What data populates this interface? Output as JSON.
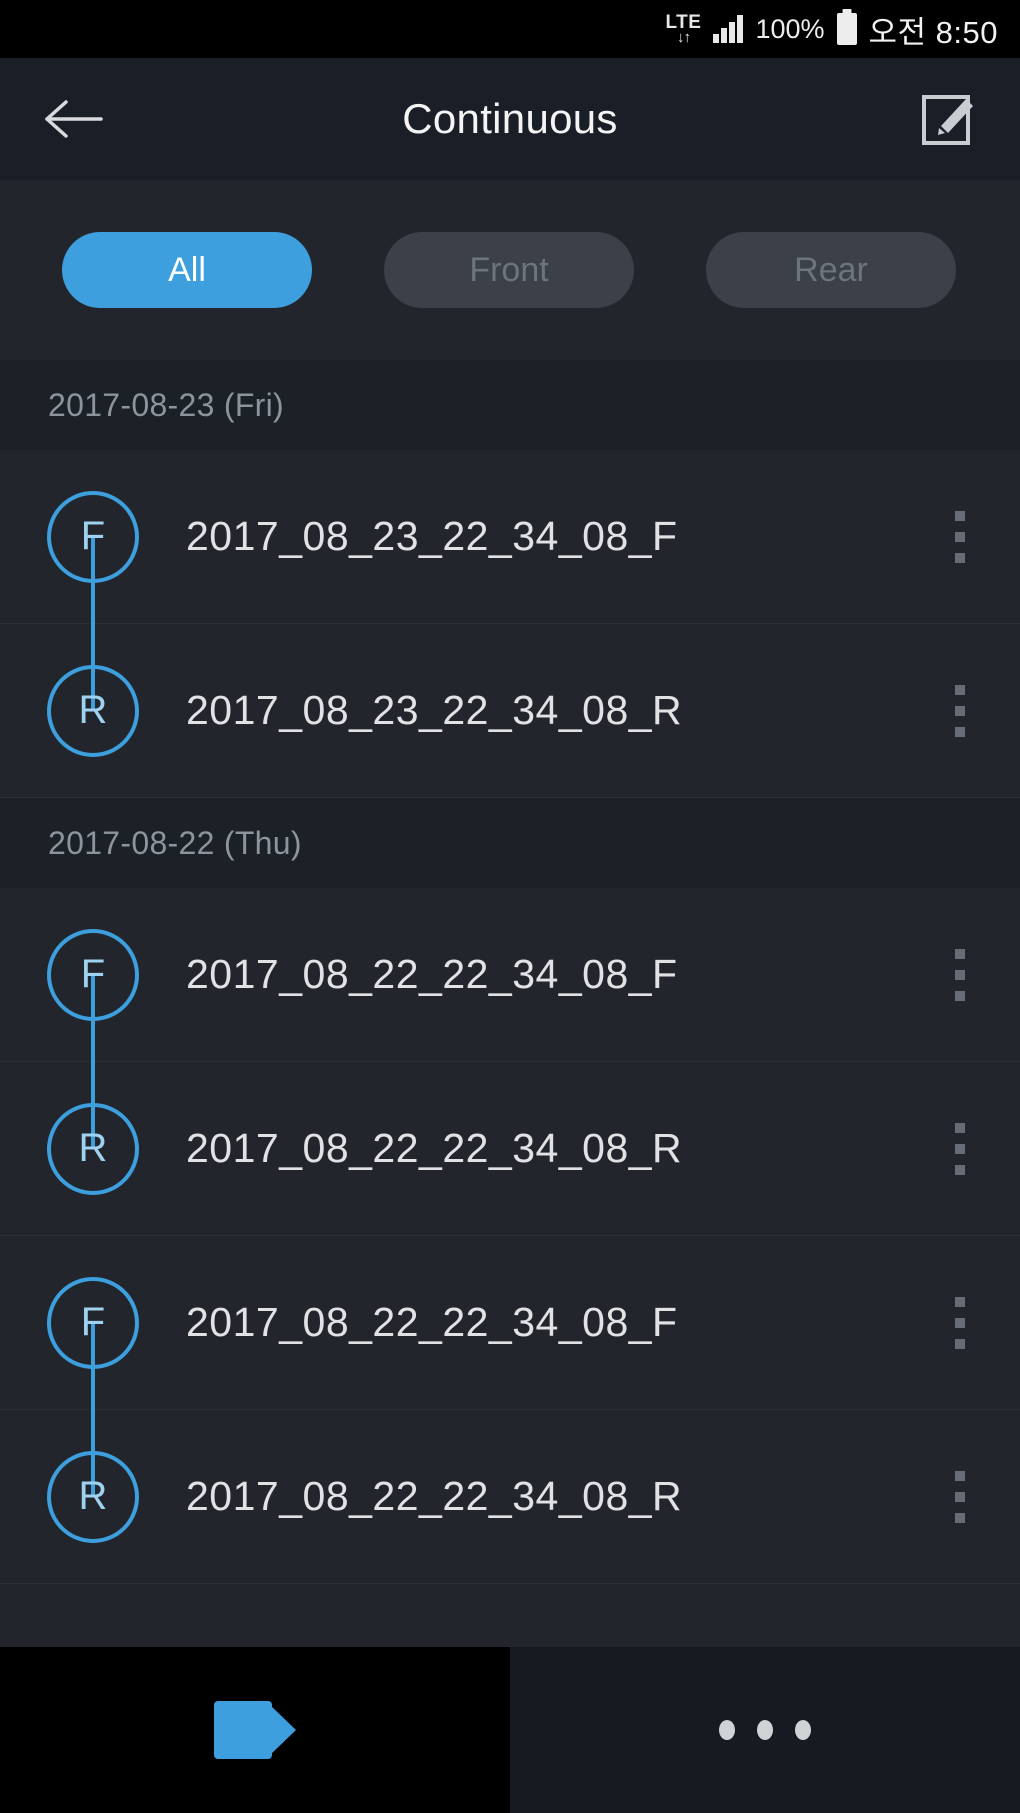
{
  "status_bar": {
    "network_label": "LTE",
    "network_arrows": "↓↑",
    "signal_icon": "signal-bars-icon",
    "battery_percent": "100%",
    "battery_icon": "battery-full-icon",
    "clock": "오전 8:50"
  },
  "app_bar": {
    "back_icon": "back-arrow-icon",
    "title": "Continuous",
    "edit_icon": "edit-icon"
  },
  "filters": [
    {
      "label": "All",
      "active": true
    },
    {
      "label": "Front",
      "active": false
    },
    {
      "label": "Rear",
      "active": false
    }
  ],
  "groups": [
    {
      "date": "2017-08-23 (Fri)",
      "rows": [
        {
          "badge": "F",
          "name": "2017_08_23_22_34_08_F",
          "connector": "down"
        },
        {
          "badge": "R",
          "name": "2017_08_23_22_34_08_R",
          "connector": "up"
        }
      ]
    },
    {
      "date": "2017-08-22 (Thu)",
      "rows": [
        {
          "badge": "F",
          "name": "2017_08_22_22_34_08_F",
          "connector": "down"
        },
        {
          "badge": "R",
          "name": "2017_08_22_22_34_08_R",
          "connector": "up"
        },
        {
          "badge": "F",
          "name": "2017_08_22_22_34_08_F",
          "connector": "down"
        },
        {
          "badge": "R",
          "name": "2017_08_22_22_34_08_R",
          "connector": "up"
        }
      ]
    }
  ],
  "nav_bar": {
    "record_icon": "video-camera-icon",
    "more_icon": "more-horizontal-icon"
  },
  "colors": {
    "accent": "#3d9fdd",
    "page_bg": "#22262c",
    "appbar_bg": "#1a1f27",
    "header_bg": "#1c2027",
    "text_primary": "#e0e2e4",
    "text_muted": "#8d949c"
  }
}
